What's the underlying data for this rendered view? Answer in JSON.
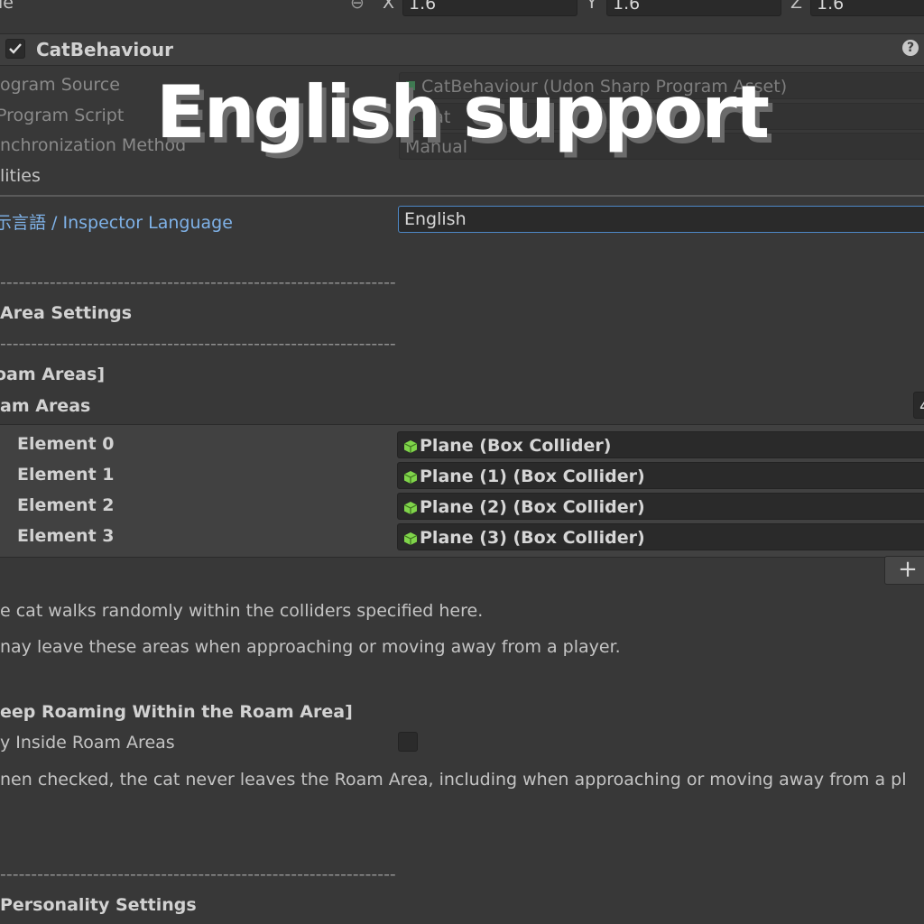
{
  "transform_row": {
    "label_partial": "le",
    "x_label": "X",
    "x_value": "1.6",
    "y_label": "Y",
    "y_value": "1.6",
    "z_label": "Z",
    "z_value": "1.6"
  },
  "component": {
    "title": "CatBehaviour",
    "enabled": true,
    "help_icon": "help-icon"
  },
  "program_rows": [
    {
      "label": "ogram Source",
      "value": "CatBehaviour (Udon Sharp Program Asset)"
    },
    {
      "label": " Program Script",
      "value": "Cat"
    },
    {
      "label": "nchronization Method",
      "value": "Manual"
    }
  ],
  "utilities_label": "lities",
  "language": {
    "label": "示言語 / Inspector Language",
    "value": "English"
  },
  "overlay_text": "English support",
  "dashes": "----------------------------------------------------------------",
  "area_settings_title": "Area Settings",
  "roam_areas_header": "oam Areas]",
  "roam_areas": {
    "label": "am Areas",
    "count": "4",
    "elements": [
      {
        "label": "Element 0",
        "value": "Plane (Box Collider)"
      },
      {
        "label": "Element 1",
        "value": "Plane (1) (Box Collider)"
      },
      {
        "label": "Element 2",
        "value": "Plane (2) (Box Collider)"
      },
      {
        "label": "Element 3",
        "value": "Plane (3) (Box Collider)"
      }
    ],
    "add_label": "+"
  },
  "roam_desc_1": "e cat walks randomly within the colliders specified here.",
  "roam_desc_2": "nay leave these areas when approaching or moving away from a player.",
  "keep_roaming_header": "eep Roaming Within the Roam Area]",
  "stay_inside": {
    "label": "y Inside Roam Areas",
    "checked": false
  },
  "stay_desc": "nen checked, the cat never leaves the Roam Area, including when approaching or moving away from a pl",
  "personality_title": "Personality Settings"
}
